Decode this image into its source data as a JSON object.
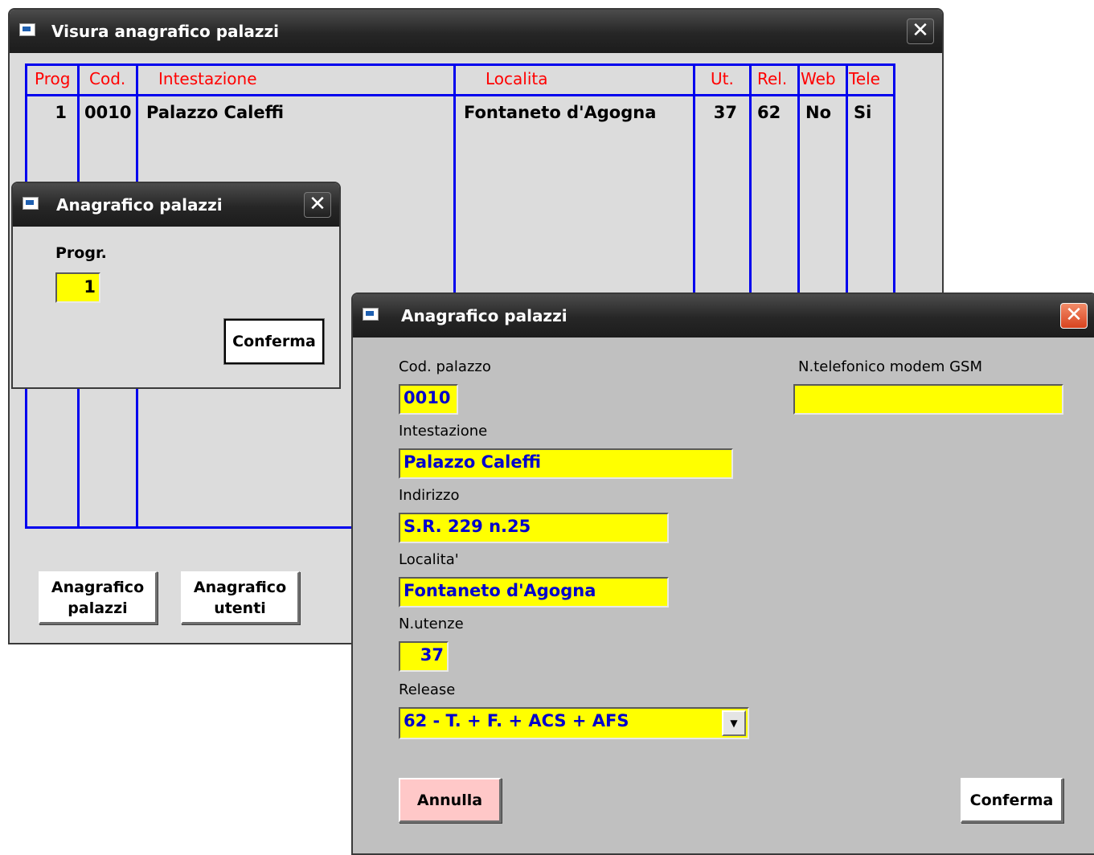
{
  "visura": {
    "title": "Visura anagrafico palazzi",
    "columns": [
      "Prog",
      "Cod.",
      "Intestazione",
      "Localita",
      "Ut.",
      "Rel.",
      "Web",
      "Tele"
    ],
    "rows": [
      {
        "prog": "1",
        "cod": "0010",
        "intestazione": "Palazzo Caleffi",
        "localita": "Fontaneto d'Agogna",
        "ut": "37",
        "rel": "62",
        "web": "No",
        "tele": "Si"
      }
    ],
    "buttons": {
      "anagrafico_palazzi": {
        "line1": "Anagrafico",
        "line2": "palazzi"
      },
      "anagrafico_utenti": {
        "line1": "Anagrafico",
        "line2": "utenti"
      }
    },
    "close_glyph": "✕"
  },
  "progr_dialog": {
    "title": "Anagrafico  palazzi",
    "label": "Progr.",
    "value": "1",
    "confirm_label": "Conferma",
    "close_glyph": "✕"
  },
  "edit_dialog": {
    "title": "Anagrafico palazzi",
    "close_glyph": "✕",
    "fields": {
      "cod_palazzo": {
        "label": "Cod. palazzo",
        "value": "0010"
      },
      "intestazione": {
        "label": "Intestazione",
        "value": "Palazzo Caleffi"
      },
      "indirizzo": {
        "label": "Indirizzo",
        "value": "S.R. 229 n.25"
      },
      "localita": {
        "label": "Localita'",
        "value": "Fontaneto d'Agogna"
      },
      "n_utenze": {
        "label": "N.utenze",
        "value": "37"
      },
      "release": {
        "label": "Release",
        "value": "62 - T. + F. + ACS + AFS"
      },
      "gsm": {
        "label": "N.telefonico modem GSM",
        "value": ""
      }
    },
    "cancel_label": "Annulla",
    "confirm_label": "Conferma",
    "dropdown_glyph": "▼"
  },
  "colors": {
    "grid": "#0000ee",
    "header_text": "#ff0000",
    "field_bg": "#ffff00",
    "field_text": "#0000cc",
    "cancel_bg": "#ffc8c8"
  }
}
